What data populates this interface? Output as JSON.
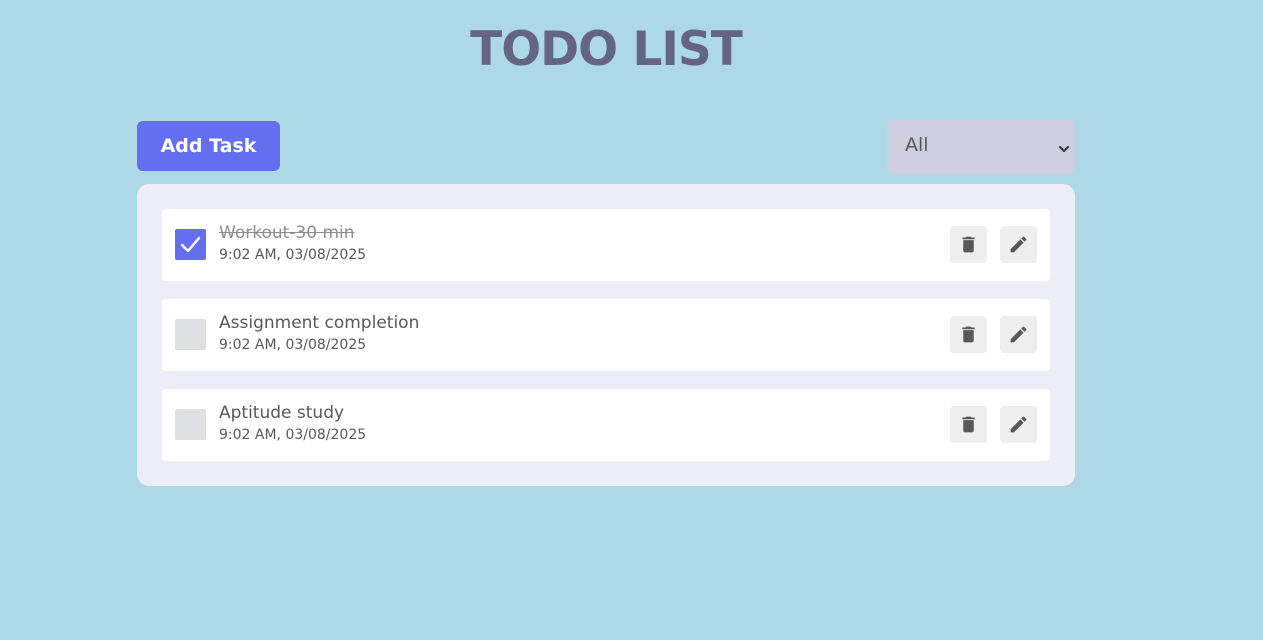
{
  "header": {
    "title": "TODO LIST"
  },
  "toolbar": {
    "add_label": "Add Task",
    "filter_value": "All"
  },
  "todos": [
    {
      "name": "Workout-30 min",
      "time": "9:02 AM, 03/08/2025",
      "done": true
    },
    {
      "name": "Assignment completion",
      "time": "9:02 AM, 03/08/2025",
      "done": false
    },
    {
      "name": "Aptitude study",
      "time": "9:02 AM, 03/08/2025",
      "done": false
    }
  ],
  "colors": {
    "background": "#add8e6",
    "accent": "#646ff0",
    "title": "#646681",
    "panel": "#ecedf6",
    "filter": "#cccdde"
  },
  "icons": {
    "delete": "trash-icon",
    "edit": "pencil-icon",
    "check": "checkmark-icon",
    "dropdown": "chevron-down-icon"
  }
}
